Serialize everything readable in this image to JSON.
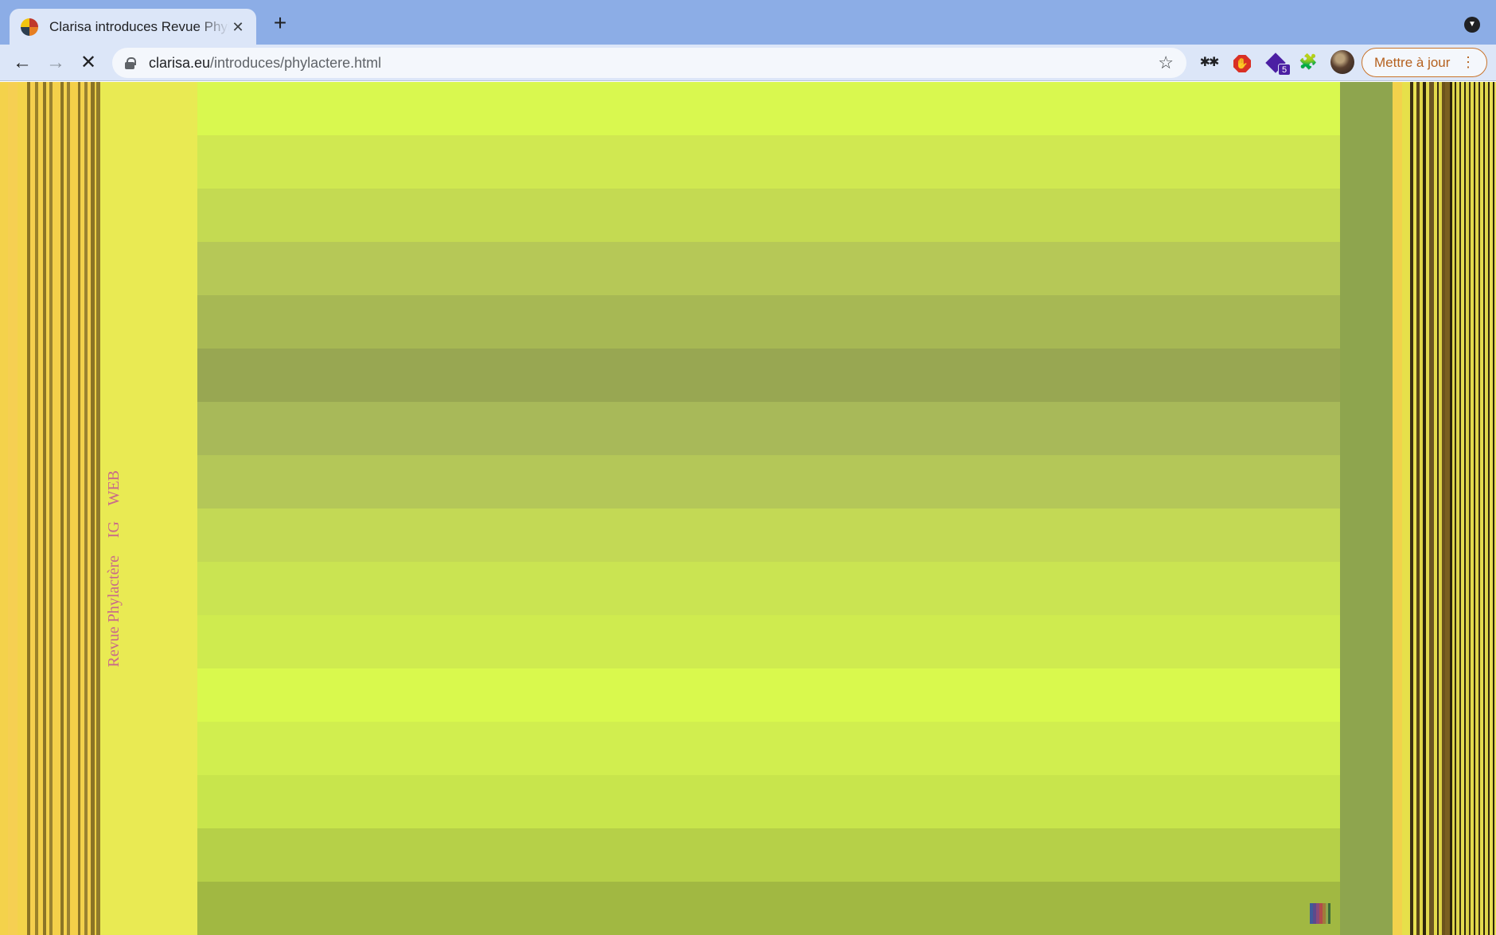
{
  "browser": {
    "tab_title": "Clarisa introduces Revue Phylactère",
    "tab_close": "✕",
    "new_tab": "+",
    "url_domain": "clarisa.eu",
    "url_path": "/introduces/phylactere.html",
    "update_button": "Mettre à jour",
    "ext_badge": "5"
  },
  "sidebar": {
    "links": [
      {
        "label": "Revue Phylactère"
      },
      {
        "label": "IG"
      },
      {
        "label": "WEB"
      }
    ]
  },
  "colors": {
    "left_panel": "#e9ea53",
    "right_column": "#8ea54e",
    "link_color": "#c96a8a",
    "bands": [
      "#d9f84f",
      "#d0e851",
      "#c4da52",
      "#b6c857",
      "#a7b854",
      "#98a752",
      "#a8b959",
      "#b4c758",
      "#c3d955",
      "#cae452",
      "#cfeb4f",
      "#d9f94d",
      "#d1ee4f",
      "#c8e54c",
      "#b6d048",
      "#a1b842"
    ]
  }
}
